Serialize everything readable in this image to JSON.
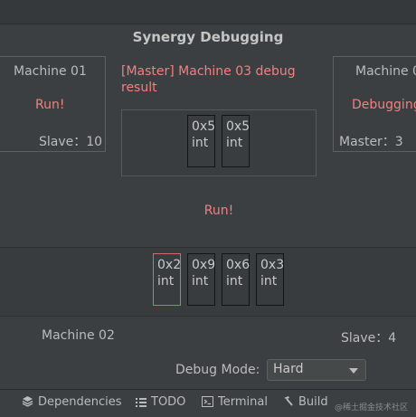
{
  "title": "Synergy Debugging",
  "left_machine": {
    "name": "Machine 01",
    "status": "Run!",
    "role": "Slave：10"
  },
  "right_machine": {
    "name": "Machine 0",
    "status": "Debugging",
    "role": "Master：3"
  },
  "debug_result": {
    "header": "[Master] Machine 03 debug result",
    "cells": [
      {
        "value": "0x5",
        "type": "int"
      },
      {
        "value": "0x5",
        "type": "int"
      }
    ]
  },
  "mid_status": "Run!",
  "memory_cells": [
    {
      "value": "0x2",
      "type": "int",
      "active": true
    },
    {
      "value": "0x9",
      "type": "int",
      "active": false
    },
    {
      "value": "0x6",
      "type": "int",
      "active": false
    },
    {
      "value": "0x3",
      "type": "int",
      "active": false
    }
  ],
  "local_machine": {
    "name": "Machine 02",
    "role": "Slave：4"
  },
  "debug_mode": {
    "label": "Debug Mode:",
    "selected": "Hard"
  },
  "toolbar": {
    "dependencies": "Dependencies",
    "todo": "TODO",
    "terminal": "Terminal",
    "build": "Build"
  },
  "watermark": "@稀土掘金技术社区",
  "colors": {
    "background": "#3c3f41",
    "accent_red": "#f08080",
    "text": "#bbbbbb"
  }
}
